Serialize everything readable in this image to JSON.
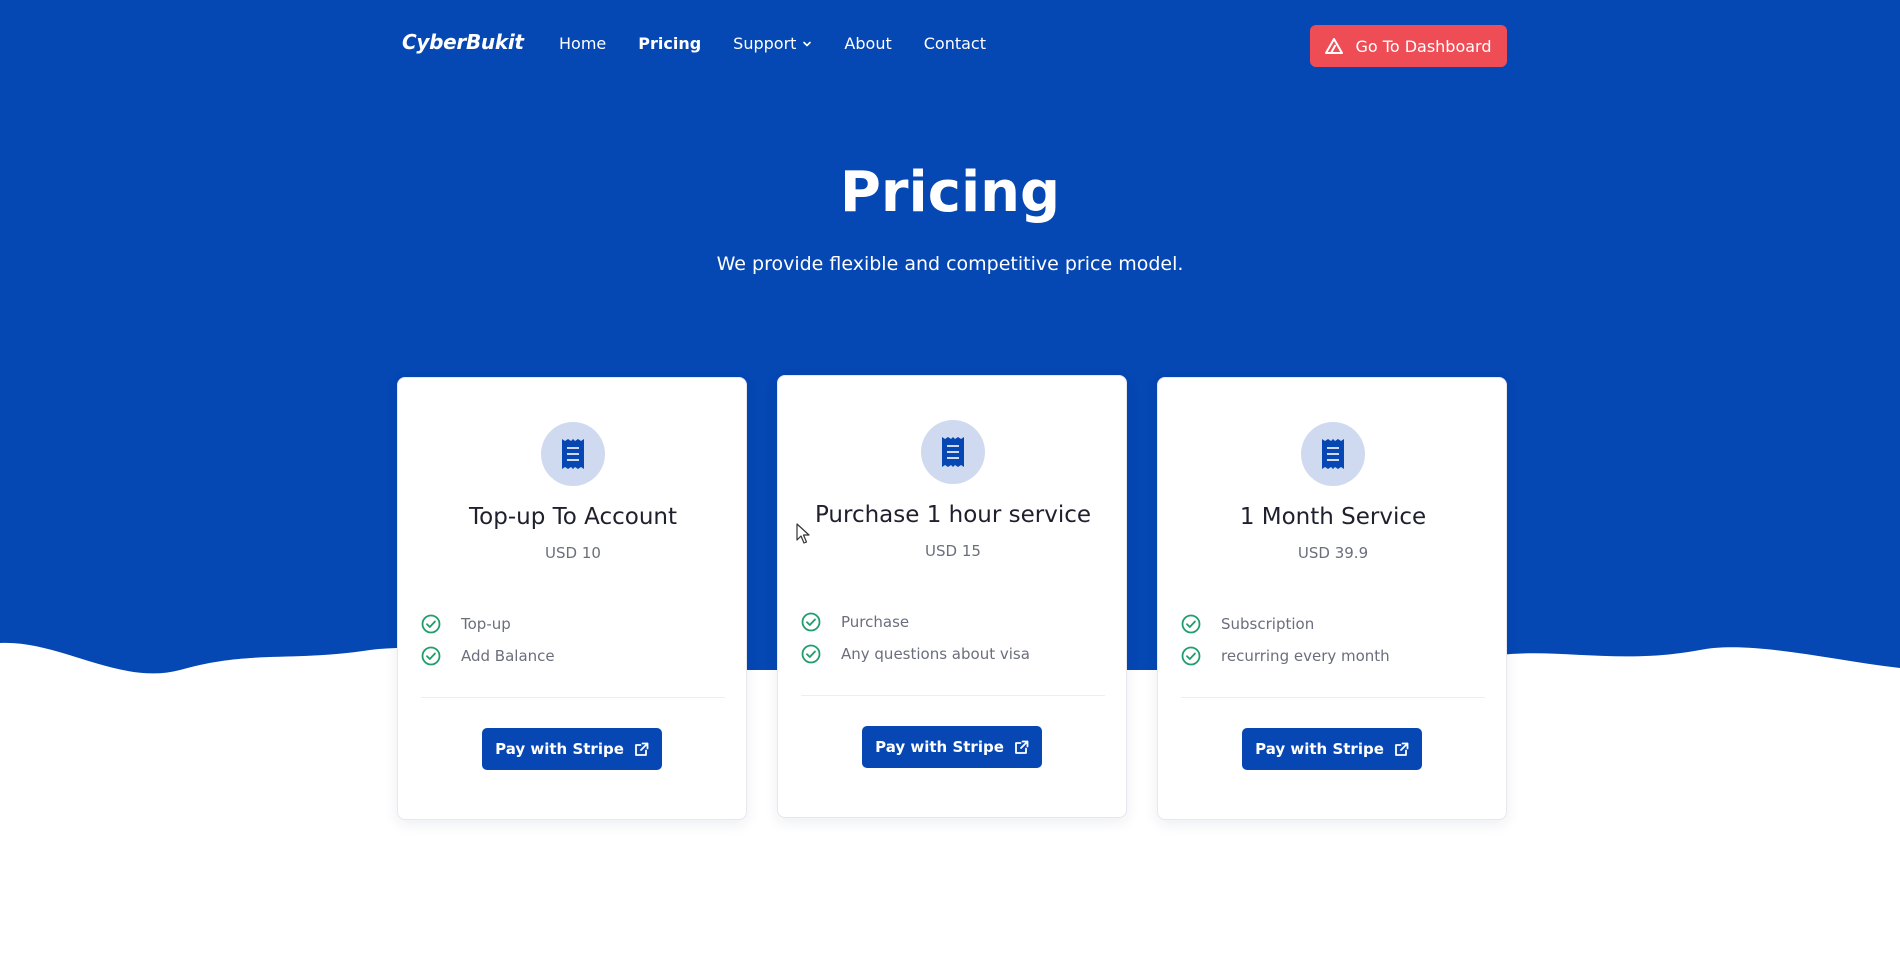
{
  "colors": {
    "brand_blue": "#0647b3",
    "hero_blue": "#0547b3",
    "cta_red": "#ef4d56",
    "check_green": "#1f9d6b",
    "icon_circle": "#cfdaf0"
  },
  "navbar": {
    "brand": "CyberBukit",
    "links": [
      {
        "label": "Home",
        "active": false
      },
      {
        "label": "Pricing",
        "active": true
      },
      {
        "label": "Support",
        "active": false,
        "dropdown": true
      },
      {
        "label": "About",
        "active": false
      },
      {
        "label": "Contact",
        "active": false
      }
    ],
    "dashboard_button": "Go To Dashboard",
    "dashboard_icon": "triangle-logo-icon"
  },
  "hero": {
    "title": "Pricing",
    "subtitle": "We provide flexible and competitive price model."
  },
  "plans": [
    {
      "icon": "receipt-icon",
      "title": "Top-up To Account",
      "price": "USD 10",
      "features": [
        "Top-up",
        "Add Balance"
      ],
      "button": "Pay with Stripe"
    },
    {
      "icon": "receipt-icon",
      "title": "Purchase 1 hour service",
      "price": "USD 15",
      "features": [
        "Purchase",
        "Any questions about visa"
      ],
      "button": "Pay with Stripe"
    },
    {
      "icon": "receipt-icon",
      "title": "1 Month Service",
      "price": "USD 39.9",
      "features": [
        "Subscription",
        "recurring every month"
      ],
      "button": "Pay with Stripe"
    }
  ]
}
